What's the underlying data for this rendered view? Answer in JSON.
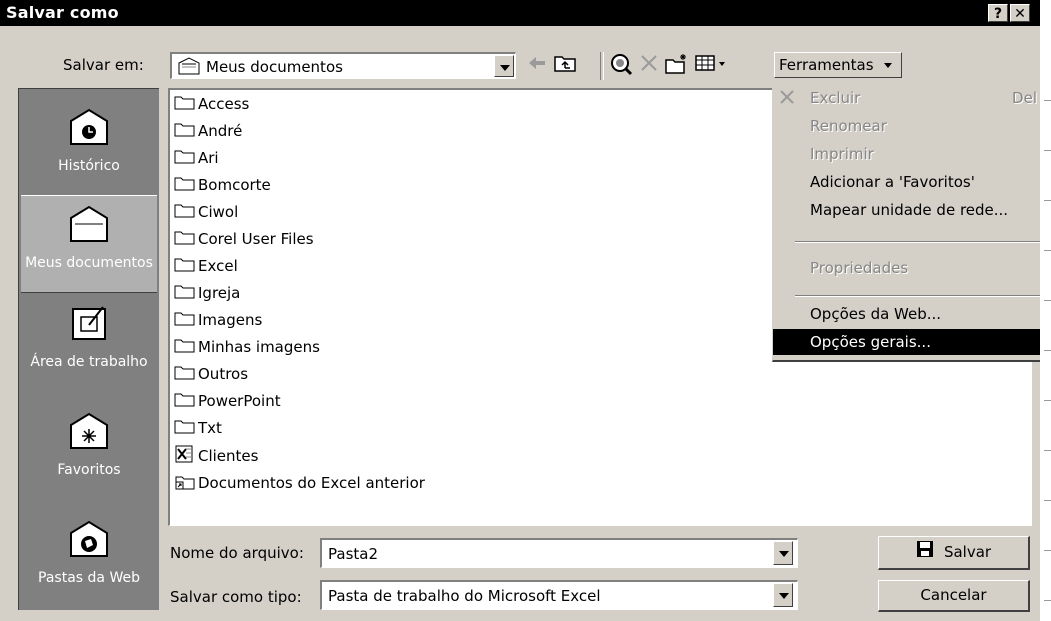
{
  "window": {
    "title": "Salvar como",
    "help_label": "?",
    "close_label": "✕"
  },
  "toolbar": {
    "save_in_label": "Salvar em:",
    "save_in_value": "Meus documentos",
    "tools_label": "Ferramentas"
  },
  "places": [
    {
      "label": "Histórico",
      "icon": "history-folder-icon"
    },
    {
      "label": "Meus documentos",
      "icon": "my-documents-folder-icon"
    },
    {
      "label": "Área de trabalho",
      "icon": "desktop-icon"
    },
    {
      "label": "Favoritos",
      "icon": "favorites-folder-icon"
    },
    {
      "label": "Pastas da Web",
      "icon": "web-folders-icon"
    }
  ],
  "files": [
    {
      "name": "Access",
      "type": "folder"
    },
    {
      "name": "André",
      "type": "folder"
    },
    {
      "name": "Ari",
      "type": "folder"
    },
    {
      "name": "Bomcorte",
      "type": "folder"
    },
    {
      "name": "Ciwol",
      "type": "folder"
    },
    {
      "name": "Corel User Files",
      "type": "folder"
    },
    {
      "name": "Excel",
      "type": "folder"
    },
    {
      "name": "Igreja",
      "type": "folder"
    },
    {
      "name": "Imagens",
      "type": "folder"
    },
    {
      "name": "Minhas imagens",
      "type": "folder"
    },
    {
      "name": "Outros",
      "type": "folder"
    },
    {
      "name": "PowerPoint",
      "type": "folder"
    },
    {
      "name": "Txt",
      "type": "folder"
    },
    {
      "name": "Clientes",
      "type": "excel-file"
    },
    {
      "name": "Documentos do Excel anterior",
      "type": "shortcut"
    }
  ],
  "tools_menu": {
    "items": [
      {
        "label": "Excluir",
        "shortcut": "Del",
        "disabled": true,
        "highlighted": false
      },
      {
        "label": "Renomear",
        "shortcut": "",
        "disabled": true,
        "highlighted": false
      },
      {
        "label": "Imprimir",
        "shortcut": "",
        "disabled": true,
        "highlighted": false
      },
      {
        "label": "Adicionar a 'Favoritos'",
        "shortcut": "",
        "disabled": false,
        "highlighted": false
      },
      {
        "label": "Mapear unidade de rede...",
        "shortcut": "",
        "disabled": false,
        "highlighted": false
      },
      {
        "label": "Propriedades",
        "shortcut": "",
        "disabled": true,
        "highlighted": false
      },
      {
        "label": "Opções da Web...",
        "shortcut": "",
        "disabled": false,
        "highlighted": false
      },
      {
        "label": "Opções gerais...",
        "shortcut": "",
        "disabled": false,
        "highlighted": true
      }
    ]
  },
  "footer": {
    "filename_label": "Nome do arquivo:",
    "filename_value": "Pasta2",
    "filetype_label": "Salvar como tipo:",
    "filetype_value": "Pasta de trabalho do Microsoft Excel",
    "save_button": "Salvar",
    "cancel_button": "Cancelar"
  }
}
